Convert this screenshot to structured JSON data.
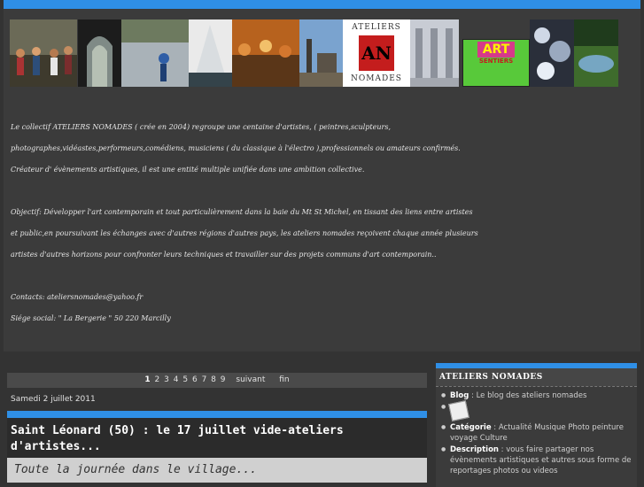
{
  "intro": {
    "line1": "Le collectif  ATELIERS NOMADES ( crée en 2004) regroupe une centaine d'artistes, ( peintres,sculpteurs,",
    "line2": "photographes,vidéastes,performeurs,comédiens, musiciens ( du classique à l'électro ),professionnels ou amateurs confirmés.",
    "line3": "Créateur d' évènements artistiques, il est une entité multiple unifiée dans une ambition collective.",
    "line4": "Objectif: Développer l'art contemporain et tout particulièrement dans la baie du Mt St Michel, en tissant des liens entre artistes",
    "line5": "et public,en poursuivant les échanges avec d'autres régions d'autres pays, les ateliers nomades reçoivent  chaque année plusieurs",
    "line6": "artistes d'autres horizons pour confronter leurs techniques  et travailler sur des projets communs d'art contemporain..",
    "line7": "Contacts: ateliersnomades@yahoo.fr",
    "line8": "Siége social: \" La Bergerie \" 50 220 Marcilly"
  },
  "logo": {
    "top": "ATELIERS",
    "mark": "AN",
    "bottom": "NOMADES"
  },
  "poster": {
    "title": "ART",
    "sub": "SENTIERS"
  },
  "pager": {
    "pages": [
      "1",
      "2",
      "3",
      "4",
      "5",
      "6",
      "7",
      "8",
      "9"
    ],
    "next": "suivant",
    "last": "fin"
  },
  "post": {
    "date": "Samedi 2 juillet 2011",
    "title": "Saint Léonard (50) : le 17 juillet vide-ateliers d'artistes...",
    "body": "Toute la journée dans le village..."
  },
  "sidebar": {
    "title": "ATELIERS NOMADES",
    "blog_label": "Blog",
    "blog_value": " : Le blog des ateliers nomades",
    "cat_label": "Catégorie",
    "cat_value": " : Actualité Musique Photo peinture voyage Culture",
    "desc_label": "Description",
    "desc_value": " : vous faire partager nos évènements artistiques et autres sous forme de reportages photos ou videos"
  },
  "colors": {
    "accent": "#2f8fe6",
    "background": "#333333"
  },
  "icons": [
    "note-icon"
  ]
}
